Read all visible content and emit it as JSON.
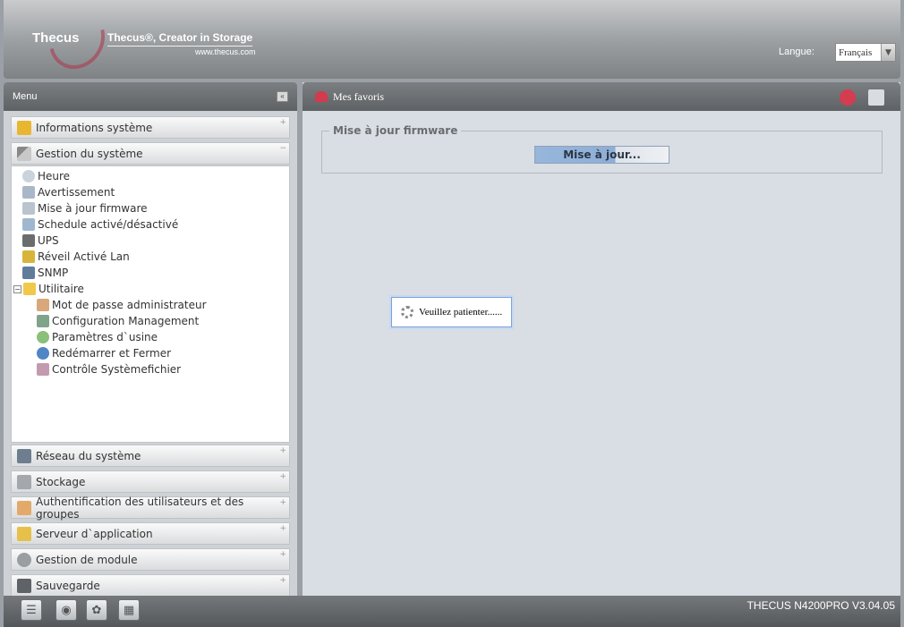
{
  "header": {
    "logo_text": "Thecus",
    "tagline": "Thecus®, Creator in Storage",
    "url": "www.thecus.com",
    "language_label": "Langue:",
    "language_value": "Français"
  },
  "menu": {
    "title": "Menu",
    "collapse_symbol": "«",
    "top_sections": [
      {
        "label": "Informations système",
        "icon": "info-icon"
      },
      {
        "label": "Gestion du système",
        "icon": "tools-icon"
      }
    ],
    "tree": [
      {
        "label": "Heure",
        "icon": "clock-icon"
      },
      {
        "label": "Avertissement",
        "icon": "warning-icon"
      },
      {
        "label": "Mise à jour firmware",
        "icon": "firmware-icon"
      },
      {
        "label": "Schedule activé/désactivé",
        "icon": "schedule-icon"
      },
      {
        "label": "UPS",
        "icon": "ups-icon"
      },
      {
        "label": "Réveil Activé Lan",
        "icon": "wol-icon"
      },
      {
        "label": "SNMP",
        "icon": "snmp-icon"
      },
      {
        "label": "Utilitaire",
        "icon": "folder-icon"
      },
      {
        "label": "Mot de passe administrateur",
        "icon": "admin-icon"
      },
      {
        "label": "Configuration Management",
        "icon": "config-icon"
      },
      {
        "label": "Paramètres d`usine",
        "icon": "factory-icon"
      },
      {
        "label": "Redémarrer et Fermer",
        "icon": "power-icon"
      },
      {
        "label": "Contrôle Systèmefichier",
        "icon": "fscheck-icon"
      }
    ],
    "bottom_sections": [
      {
        "label": "Réseau du système",
        "icon": "network-icon"
      },
      {
        "label": "Stockage",
        "icon": "storage-icon"
      },
      {
        "label": "Authentification des utilisateurs et des groupes",
        "icon": "users-icon"
      },
      {
        "label": "Serveur d`application",
        "icon": "app-server-icon"
      },
      {
        "label": "Gestion de module",
        "icon": "module-icon"
      },
      {
        "label": "Sauvegarde",
        "icon": "backup-icon"
      }
    ]
  },
  "content": {
    "favorites_label": "Mes favoris",
    "fieldset_legend": "Mise à jour firmware",
    "update_button": "Mise à jour...",
    "wait_message": "Veuillez patienter......"
  },
  "footer": {
    "version": "THECUS N4200PRO V3.04.05"
  },
  "colors": {
    "header_gradient_top": "#c9cbcd",
    "panel_bar": "#6b6e71",
    "content_bg": "#d9dee4",
    "accent_blue": "#8faed6"
  }
}
